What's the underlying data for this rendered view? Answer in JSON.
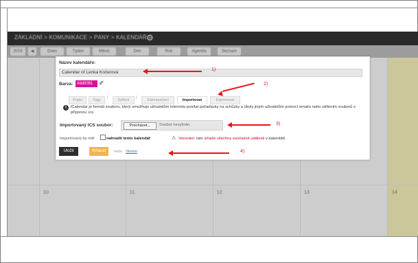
{
  "app": {
    "breadcrumbs": "ZÁKLADNÍ > KOMUNIKACE > PÁNY > KALENDÁŘ",
    "toolbar_buttons": [
      "2015",
      "◀",
      "Dnes",
      "Týden",
      "Měsíc",
      "Den",
      "Rok",
      "Agenda",
      "Seznam"
    ],
    "day_numbers": [
      "10",
      "11",
      "12",
      "13",
      "14"
    ]
  },
  "dialog": {
    "calendar_name_label": "Název kalendáře:",
    "calendar_name_value": "Calendar of Lenka Kočerová",
    "color_label": "Barva:",
    "color_value": "#dd0091",
    "tabs": [
      "Popis",
      "Tagy",
      "Sdílení",
      "Zabezpečení",
      "Importovat",
      "Exportovat"
    ],
    "info_text": "iCalendar je formát souboru, který umožňuje uživatelům internetu posílat požadavky na schůzky a úkoly jiným uživatelům pomocí emailu nebo sdílením souborů s příponou .ics",
    "import_label": "Importovaný ICS soubor:",
    "file_button": "Procházet...",
    "file_status": "Soubor nevybrán.",
    "option_prefix": "Importovaný by měl",
    "option_bold": "nahradit tento kalendář",
    "warning_label": "Varování:",
    "warning_text": "tato",
    "warning_red": "smaže všechny současné události",
    "warning_suffix": "v kalendáři.",
    "save_button": "Uložit",
    "delete_button": "Smazat",
    "or_text": "nebo",
    "cancel_link": "Storno"
  },
  "annotations": [
    "1)",
    "2)",
    "3)",
    "4)"
  ],
  "colors": {
    "accent": "#d8119a",
    "annotation": "#e8141b",
    "delete_button": "#f2b44c",
    "highlight_column": "#cbc79a"
  }
}
